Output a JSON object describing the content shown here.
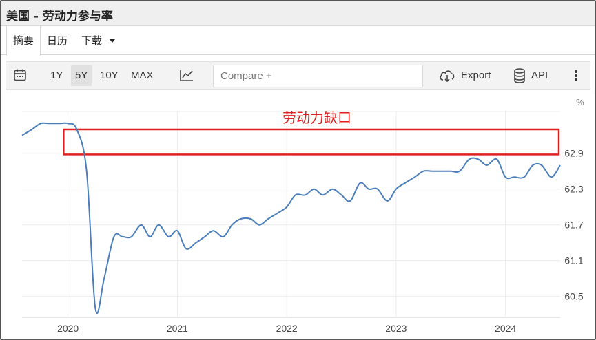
{
  "window": {
    "title": "美国 - 劳动力参与率"
  },
  "tabs": [
    {
      "label": "摘要",
      "active": true
    },
    {
      "label": "日历",
      "active": false
    },
    {
      "label": "下载",
      "active": false
    }
  ],
  "toolbar": {
    "calendar_icon": "calendar-icon",
    "ranges": [
      {
        "label": "1Y",
        "active": false
      },
      {
        "label": "5Y",
        "active": true
      },
      {
        "label": "10Y",
        "active": false
      },
      {
        "label": "MAX",
        "active": false
      }
    ],
    "chart_type_icon": "line-chart-icon",
    "compare_placeholder": "Compare +",
    "export_label": "Export",
    "export_icon": "cloud-download-icon",
    "api_label": "API",
    "api_icon": "database-icon",
    "more_icon": "more-vertical-icon"
  },
  "colors": {
    "line": "#4a7ebb",
    "annotation": "#e02020",
    "grid": "#ececec"
  },
  "chart_data": {
    "type": "line",
    "unit_label": "%",
    "annotation": {
      "label": "劳动力缺口",
      "y_range": [
        62.88,
        63.3
      ],
      "x_range": [
        2019.96,
        2024.5
      ]
    },
    "xlim": [
      2019.58,
      2024.5
    ],
    "ylim": [
      60.15,
      63.6
    ],
    "y_ticks": [
      {
        "value": 62.9,
        "label": "62.9"
      },
      {
        "value": 62.3,
        "label": "62.3"
      },
      {
        "value": 61.7,
        "label": "61.7"
      },
      {
        "value": 61.1,
        "label": "61.1"
      },
      {
        "value": 60.5,
        "label": "60.5"
      }
    ],
    "x_ticks": [
      {
        "value": 2020.0,
        "label": "2020"
      },
      {
        "value": 2021.0,
        "label": "2021"
      },
      {
        "value": 2022.0,
        "label": "2022"
      },
      {
        "value": 2023.0,
        "label": "2023"
      },
      {
        "value": 2024.0,
        "label": "2024"
      }
    ],
    "series": [
      {
        "values": [
          [
            2019.58,
            63.2
          ],
          [
            2019.67,
            63.3
          ],
          [
            2019.75,
            63.4
          ],
          [
            2019.83,
            63.4
          ],
          [
            2019.92,
            63.4
          ],
          [
            2020.0,
            63.4
          ],
          [
            2020.08,
            63.3
          ],
          [
            2020.17,
            62.6
          ],
          [
            2020.25,
            60.3
          ],
          [
            2020.33,
            60.8
          ],
          [
            2020.42,
            61.5
          ],
          [
            2020.5,
            61.5
          ],
          [
            2020.58,
            61.5
          ],
          [
            2020.67,
            61.7
          ],
          [
            2020.75,
            61.5
          ],
          [
            2020.83,
            61.7
          ],
          [
            2020.92,
            61.5
          ],
          [
            2021.0,
            61.6
          ],
          [
            2021.08,
            61.3
          ],
          [
            2021.17,
            61.4
          ],
          [
            2021.25,
            61.5
          ],
          [
            2021.33,
            61.6
          ],
          [
            2021.42,
            61.5
          ],
          [
            2021.5,
            61.7
          ],
          [
            2021.58,
            61.8
          ],
          [
            2021.67,
            61.8
          ],
          [
            2021.75,
            61.7
          ],
          [
            2021.83,
            61.8
          ],
          [
            2021.92,
            61.9
          ],
          [
            2022.0,
            62.0
          ],
          [
            2022.08,
            62.2
          ],
          [
            2022.17,
            62.2
          ],
          [
            2022.25,
            62.3
          ],
          [
            2022.33,
            62.2
          ],
          [
            2022.42,
            62.3
          ],
          [
            2022.5,
            62.2
          ],
          [
            2022.58,
            62.1
          ],
          [
            2022.67,
            62.4
          ],
          [
            2022.75,
            62.3
          ],
          [
            2022.83,
            62.3
          ],
          [
            2022.92,
            62.1
          ],
          [
            2023.0,
            62.3
          ],
          [
            2023.08,
            62.4
          ],
          [
            2023.17,
            62.5
          ],
          [
            2023.25,
            62.6
          ],
          [
            2023.33,
            62.6
          ],
          [
            2023.42,
            62.6
          ],
          [
            2023.5,
            62.6
          ],
          [
            2023.58,
            62.6
          ],
          [
            2023.67,
            62.8
          ],
          [
            2023.75,
            62.8
          ],
          [
            2023.83,
            62.7
          ],
          [
            2023.92,
            62.8
          ],
          [
            2024.0,
            62.5
          ],
          [
            2024.08,
            62.5
          ],
          [
            2024.17,
            62.5
          ],
          [
            2024.25,
            62.7
          ],
          [
            2024.33,
            62.7
          ],
          [
            2024.42,
            62.5
          ],
          [
            2024.5,
            62.7
          ]
        ]
      }
    ]
  }
}
